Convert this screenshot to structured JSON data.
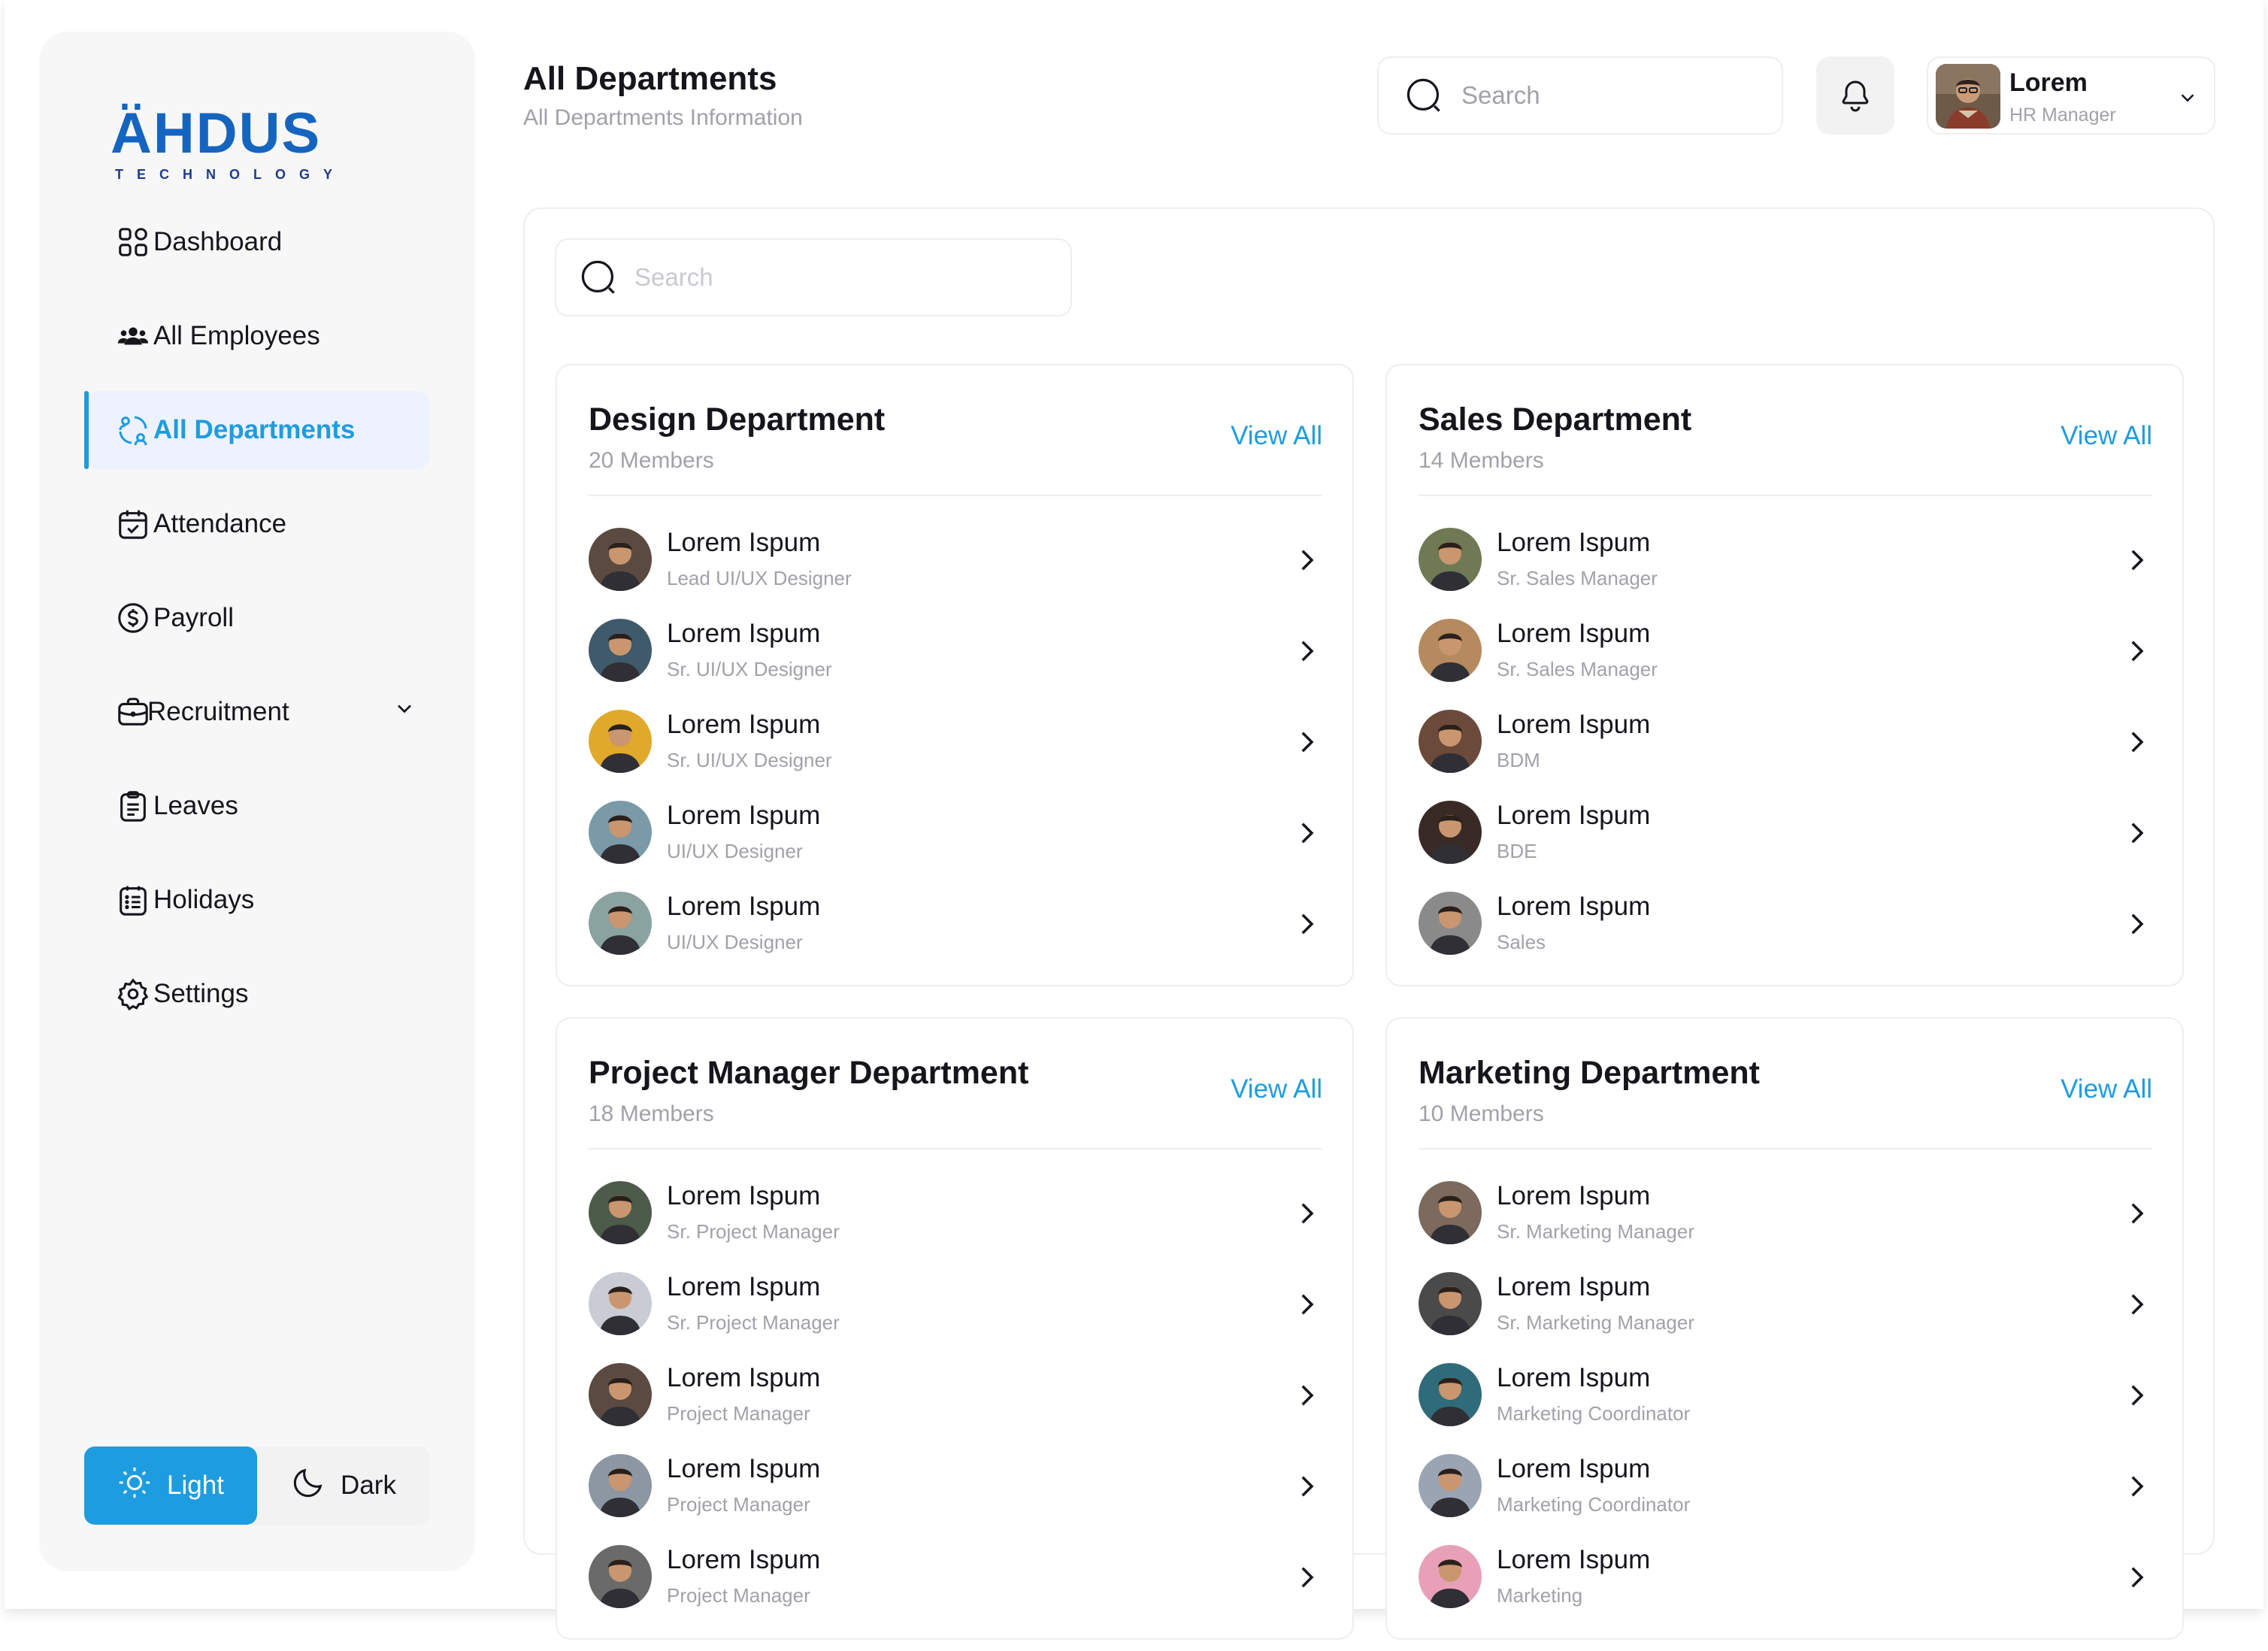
{
  "brand": {
    "name": "ÄHDUS",
    "tagline": "TECHNOLOGY",
    "color": "#1565c0"
  },
  "accent": "#1e9ce0",
  "header": {
    "title": "All Departments",
    "subtitle": "All Departments Information",
    "search_placeholder": "Search"
  },
  "user": {
    "name": "Lorem",
    "role": "HR Manager"
  },
  "sidebar": {
    "items": [
      {
        "label": "Dashboard",
        "icon": "dashboard-grid-icon"
      },
      {
        "label": "All Employees",
        "icon": "users-icon"
      },
      {
        "label": "All Departments",
        "icon": "departments-icon",
        "active": true
      },
      {
        "label": "Attendance",
        "icon": "calendar-check-icon"
      },
      {
        "label": "Payroll",
        "icon": "dollar-circle-icon"
      },
      {
        "label": "Recruitment",
        "icon": "briefcase-icon",
        "expandable": true
      },
      {
        "label": "Leaves",
        "icon": "clipboard-icon"
      },
      {
        "label": "Holidays",
        "icon": "list-calendar-icon"
      },
      {
        "label": "Settings",
        "icon": "gear-icon"
      }
    ],
    "theme": {
      "light_label": "Light",
      "dark_label": "Dark",
      "selected": "Light"
    }
  },
  "content": {
    "search_placeholder": "Search"
  },
  "departments": [
    {
      "title": "Design Department",
      "members": "20 Members",
      "view_all": "View All",
      "employees": [
        {
          "name": "Lorem Ispum",
          "role": "Lead UI/UX Designer",
          "avatar_color": "#5b4a3f"
        },
        {
          "name": "Lorem Ispum",
          "role": "Sr. UI/UX Designer",
          "avatar_color": "#3f5a6b"
        },
        {
          "name": "Lorem Ispum",
          "role": "Sr. UI/UX Designer",
          "avatar_color": "#e0a92c"
        },
        {
          "name": "Lorem Ispum",
          "role": "UI/UX Designer",
          "avatar_color": "#7a9aa8"
        },
        {
          "name": "Lorem Ispum",
          "role": "UI/UX Designer",
          "avatar_color": "#8aa3a0"
        }
      ]
    },
    {
      "title": "Sales Department",
      "members": "14 Members",
      "view_all": "View All",
      "employees": [
        {
          "name": "Lorem Ispum",
          "role": "Sr. Sales Manager",
          "avatar_color": "#6f7a55"
        },
        {
          "name": "Lorem Ispum",
          "role": "Sr. Sales Manager",
          "avatar_color": "#b58a5e"
        },
        {
          "name": "Lorem Ispum",
          "role": "BDM",
          "avatar_color": "#6b4a3a"
        },
        {
          "name": "Lorem Ispum",
          "role": "BDE",
          "avatar_color": "#3a2a26"
        },
        {
          "name": "Lorem Ispum",
          "role": "Sales",
          "avatar_color": "#8a8a8a"
        }
      ]
    },
    {
      "title": "Project Manager Department",
      "members": "18 Members",
      "view_all": "View All",
      "employees": [
        {
          "name": "Lorem Ispum",
          "role": "Sr. Project Manager",
          "avatar_color": "#4d5b4a"
        },
        {
          "name": "Lorem Ispum",
          "role": "Sr. Project Manager",
          "avatar_color": "#c9ccd4"
        },
        {
          "name": "Lorem Ispum",
          "role": "Project Manager",
          "avatar_color": "#5a4a42"
        },
        {
          "name": "Lorem Ispum",
          "role": "Project Manager",
          "avatar_color": "#8d97a3"
        },
        {
          "name": "Lorem Ispum",
          "role": "Project Manager",
          "avatar_color": "#6a6a6a"
        }
      ]
    },
    {
      "title": "Marketing Department",
      "members": "10 Members",
      "view_all": "View All",
      "employees": [
        {
          "name": "Lorem Ispum",
          "role": "Sr. Marketing Manager",
          "avatar_color": "#7c6a5e"
        },
        {
          "name": "Lorem Ispum",
          "role": "Sr. Marketing Manager",
          "avatar_color": "#4a4a4a"
        },
        {
          "name": "Lorem Ispum",
          "role": "Marketing Coordinator",
          "avatar_color": "#2f6b7a"
        },
        {
          "name": "Lorem Ispum",
          "role": "Marketing Coordinator",
          "avatar_color": "#9aa4b2"
        },
        {
          "name": "Lorem Ispum",
          "role": "Marketing",
          "avatar_color": "#e8a0b8"
        }
      ]
    }
  ]
}
